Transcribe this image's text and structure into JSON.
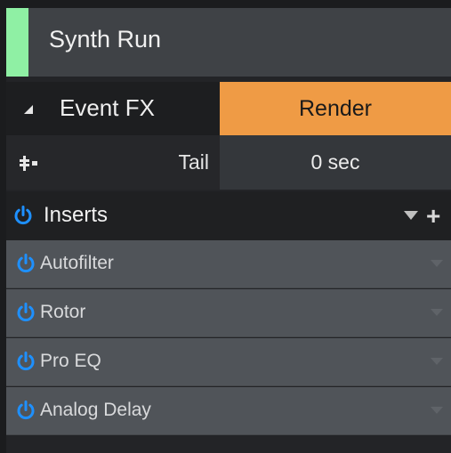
{
  "track": {
    "name": "Synth Run",
    "color": "#8ff0a4"
  },
  "event_fx": {
    "label": "Event FX",
    "render_label": "Render",
    "render_color": "#ef9b45"
  },
  "tail": {
    "label": "Tail",
    "value": "0 sec"
  },
  "inserts": {
    "label": "Inserts",
    "power_color": "#1e90ff",
    "add_symbol": "+",
    "plugins": [
      {
        "label": "Autofilter"
      },
      {
        "label": "Rotor"
      },
      {
        "label": "Pro EQ"
      },
      {
        "label": "Analog Delay"
      }
    ]
  },
  "icons": [
    "tail-icon",
    "power-icon",
    "dropdown-arrow-icon",
    "plus-icon",
    "collapse-triangle-icon"
  ]
}
